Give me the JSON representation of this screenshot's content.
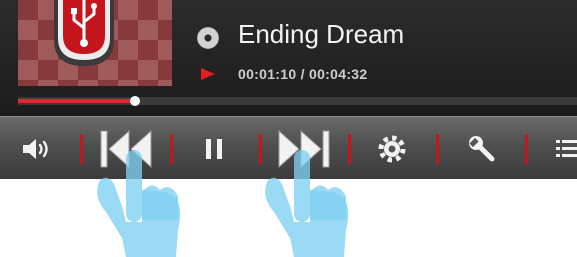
{
  "track": {
    "title": "Ending Dream",
    "time": "00:01:10 / 00:04:32",
    "progress_fraction": 0.21
  },
  "colors": {
    "accent_red": "#d82a2a",
    "panel_dark": "#262626",
    "control_bar": "#4f4f4f",
    "album_red": "#863a3c",
    "hand_blue": "#7fcff2"
  },
  "icons": {
    "album_logo": "usb-logo-icon",
    "disc": "disc-icon",
    "play_state": "play-icon",
    "volume": "volume-icon",
    "previous": "previous-track-icon",
    "pause": "pause-icon",
    "next": "next-track-icon",
    "settings": "gear-icon",
    "tools": "wrench-icon",
    "menu": "list-menu-icon",
    "hands": "pointing-hand-icon"
  }
}
